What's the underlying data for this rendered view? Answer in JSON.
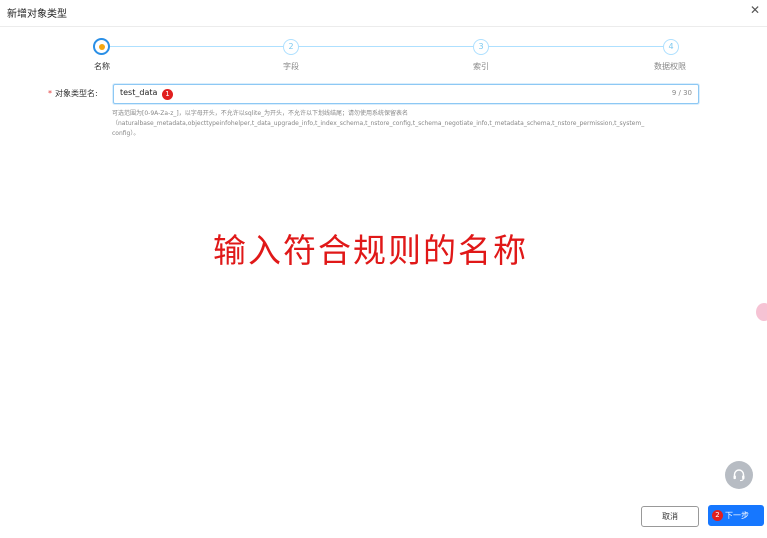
{
  "dialog": {
    "title": "新增对象类型",
    "close_glyph": "✕"
  },
  "steps": [
    {
      "number": "",
      "label": "名称",
      "state": "active"
    },
    {
      "number": "2",
      "label": "字段",
      "state": "pending"
    },
    {
      "number": "3",
      "label": "索引",
      "state": "pending"
    },
    {
      "number": "4",
      "label": "数据权限",
      "state": "pending"
    }
  ],
  "form": {
    "required_mark": "*",
    "label": "对象类型名:",
    "value": "test_data",
    "counter": "9 / 30",
    "hint_lines": [
      "可选范围为[0-9A-Za-z_]，以字母开头，不允许以sqlite_为开头，不允许以下划线结尾；请勿使用系统保留表名",
      "（naturalbase_metadata,objecttypeinfohelper,t_data_upgrade_info,t_index_schema,t_nstore_config,t_schema_negotiate_info,t_metadata_schema,t_nstore_permission,t_system_",
      "config）。"
    ]
  },
  "annotations": {
    "badge1": "1",
    "badge2": "2",
    "main_text": "输入符合规则的名称"
  },
  "footer": {
    "cancel_label": "取消",
    "next_label": "下一步"
  },
  "colors": {
    "primary": "#1677ff",
    "annotation_red": "#e01818",
    "step_active_dot": "#f4a612"
  }
}
